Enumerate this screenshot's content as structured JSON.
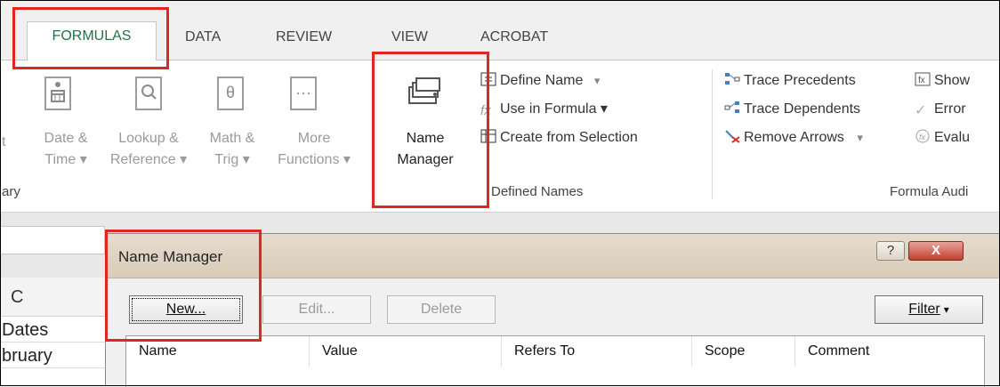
{
  "tabs": [
    "FORMULAS",
    "DATA",
    "REVIEW",
    "VIEW",
    "ACROBAT"
  ],
  "function_library": {
    "partial_left_label": "t",
    "buttons": [
      {
        "line1": "Date &",
        "line2": "Time ▾",
        "icon": "calendar-icon"
      },
      {
        "line1": "Lookup &",
        "line2": "Reference ▾",
        "icon": "lookup-icon"
      },
      {
        "line1": "Math &",
        "line2": "Trig ▾",
        "icon": "math-icon"
      },
      {
        "line1": "More",
        "line2": "Functions ▾",
        "icon": "more-functions-icon"
      }
    ],
    "group_label": "ary"
  },
  "defined_names": {
    "name_manager": {
      "line1": "Name",
      "line2": "Manager"
    },
    "define_name": "Define Name",
    "define_name_arrow": "▾",
    "use_in_formula": "Use in Formula ▾",
    "create_from_selection": "Create from Selection",
    "group_label": "Defined Names"
  },
  "formula_auditing": {
    "trace_precedents": "Trace Precedents",
    "trace_dependents": "Trace Dependents",
    "remove_arrows": "Remove Arrows",
    "remove_arrows_arrow": "▾",
    "show": "Show",
    "error": "Error",
    "evaluate": "Evalu",
    "group_label": "Formula Audi"
  },
  "sheet": {
    "column_header": "C",
    "cells": [
      "Dates",
      "bruary"
    ]
  },
  "dialog": {
    "title": "Name Manager",
    "help_label": "?",
    "close_label": "X",
    "new_label": "New...",
    "edit_label": "Edit...",
    "delete_label": "Delete",
    "filter_label": "Filter",
    "filter_arrow": "▾",
    "columns": [
      "Name",
      "Value",
      "Refers To",
      "Scope",
      "Comment"
    ]
  },
  "colors": {
    "highlight": "#e0261f",
    "tab_active": "#217346",
    "close_button": "#c1402f"
  }
}
